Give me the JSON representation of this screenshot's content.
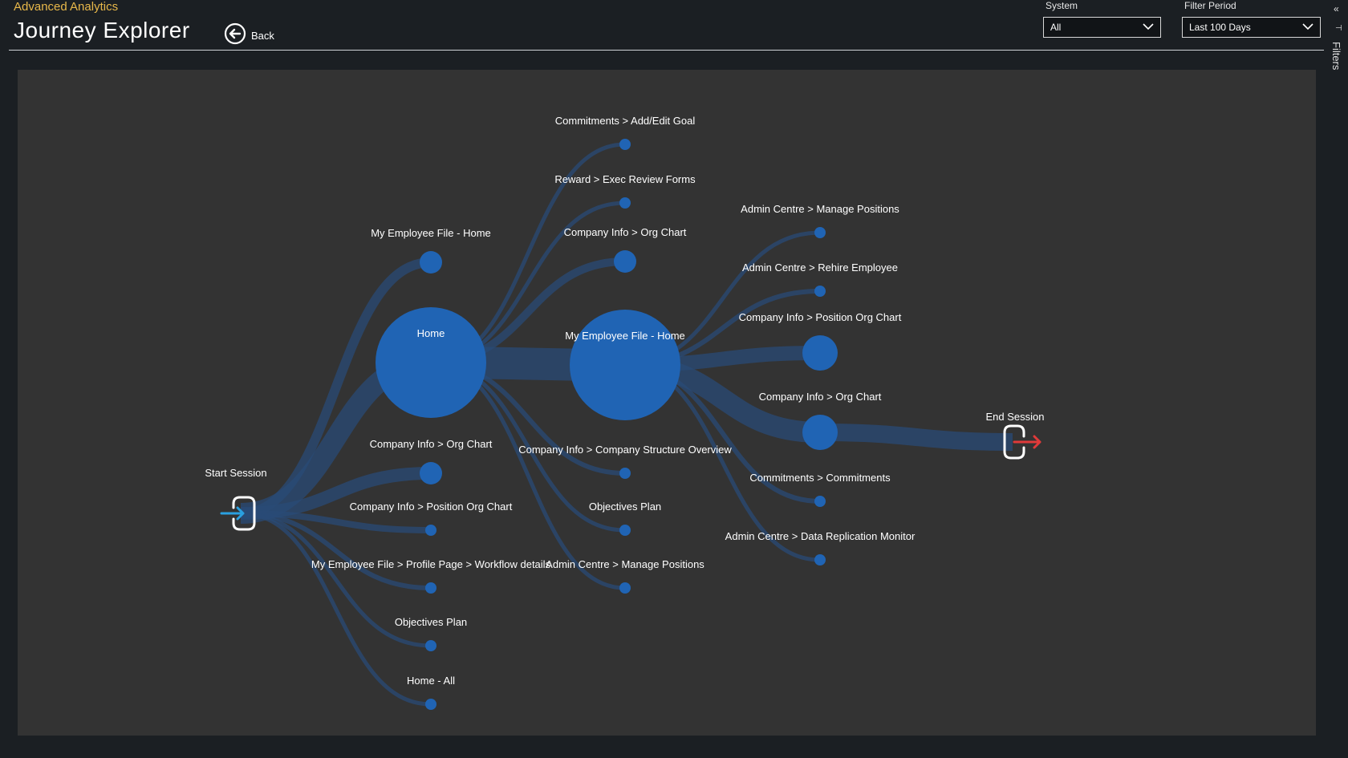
{
  "header": {
    "subtitle": "Advanced Analytics",
    "title": "Journey Explorer",
    "back_label": "Back"
  },
  "filters": {
    "system": {
      "label": "System",
      "value": "All"
    },
    "period": {
      "label": "Filter Period",
      "value": "Last 100 Days"
    },
    "pane_label": "Filters"
  },
  "colors": {
    "node": "#2064b4",
    "link": "#2a4b77",
    "panel": "#333333",
    "end_arrow": "#e03a3a",
    "start_arrow": "#2aa0e0",
    "subtitle": "#e8b84a"
  },
  "journey": {
    "start_label": "Start Session",
    "end_label": "End Session",
    "nodes": [
      {
        "id": "l1-home",
        "label": "Home",
        "size": "large"
      },
      {
        "id": "l1-emp",
        "label": "My Employee File - Home",
        "size": "small"
      },
      {
        "id": "l1-org",
        "label": "Company Info > Org Chart",
        "size": "small"
      },
      {
        "id": "l1-pos",
        "label": "Company Info > Position Org Chart",
        "size": "tiny"
      },
      {
        "id": "l1-wf",
        "label": "My Employee File > Profile Page > Workflow details",
        "size": "tiny"
      },
      {
        "id": "l1-obj",
        "label": "Objectives Plan",
        "size": "tiny"
      },
      {
        "id": "l1-homeall",
        "label": "Home - All",
        "size": "tiny"
      },
      {
        "id": "l2-goal",
        "label": "Commitments > Add/Edit Goal",
        "size": "tiny"
      },
      {
        "id": "l2-reward",
        "label": "Reward > Exec Review Forms",
        "size": "tiny"
      },
      {
        "id": "l2-org",
        "label": "Company Info > Org Chart",
        "size": "small"
      },
      {
        "id": "l2-emp",
        "label": "My Employee File - Home",
        "size": "large"
      },
      {
        "id": "l2-struct",
        "label": "Company Info > Company Structure Overview",
        "size": "tiny"
      },
      {
        "id": "l2-obj",
        "label": "Objectives Plan",
        "size": "tiny"
      },
      {
        "id": "l2-manage",
        "label": "Admin Centre > Manage Positions",
        "size": "tiny"
      },
      {
        "id": "l3-manage",
        "label": "Admin Centre > Manage Positions",
        "size": "tiny"
      },
      {
        "id": "l3-rehire",
        "label": "Admin Centre > Rehire Employee",
        "size": "tiny"
      },
      {
        "id": "l3-pos",
        "label": "Company Info > Position Org Chart",
        "size": "medium"
      },
      {
        "id": "l3-org",
        "label": "Company Info > Org Chart",
        "size": "medium"
      },
      {
        "id": "l3-commit",
        "label": "Commitments > Commitments",
        "size": "tiny"
      },
      {
        "id": "l3-repl",
        "label": "Admin Centre > Data Replication Monitor",
        "size": "tiny"
      }
    ]
  }
}
